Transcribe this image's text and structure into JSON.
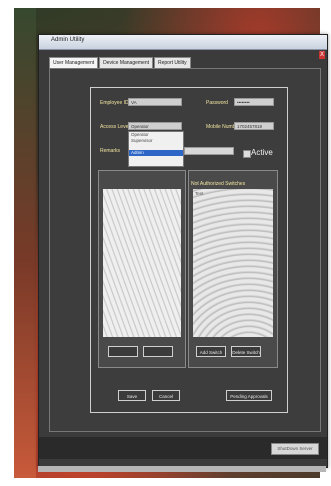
{
  "window": {
    "title": "Admin Utility",
    "close_label": "X"
  },
  "tabs": [
    {
      "label": "User Management",
      "active": true
    },
    {
      "label": "Device Management",
      "active": false
    },
    {
      "label": "Report Utility",
      "active": false
    }
  ],
  "form": {
    "employee_id_label": "Employee ID",
    "employee_id_value": "VA",
    "password_label": "Password",
    "password_value": "••••••••",
    "access_level_label": "Access Level",
    "access_level_value": "Operator",
    "access_level_options": [
      "Operator",
      "Supervisor",
      "Admin"
    ],
    "access_level_selected": "Admin",
    "mobile_label": "Mobile Number",
    "mobile_value": "1702457818",
    "remarks_label": "Remarks",
    "remarks_value": "",
    "active_label": "Active"
  },
  "switch_panel": {
    "title": "Not Authorized Switches",
    "item": "Test"
  },
  "buttons": {
    "left_panel_1": "",
    "left_panel_2": "",
    "add_switch": "Add Switch",
    "delete_switch": "Delete Switch",
    "save": "Save",
    "cancel": "Cancel",
    "pending_approvals": "Pending Approvals",
    "shutdown_server": "ShutDown Server"
  },
  "colors": {
    "window_bg": "#3b3b3b",
    "label_text": "#f2e4a0",
    "selection": "#2e66c8"
  }
}
